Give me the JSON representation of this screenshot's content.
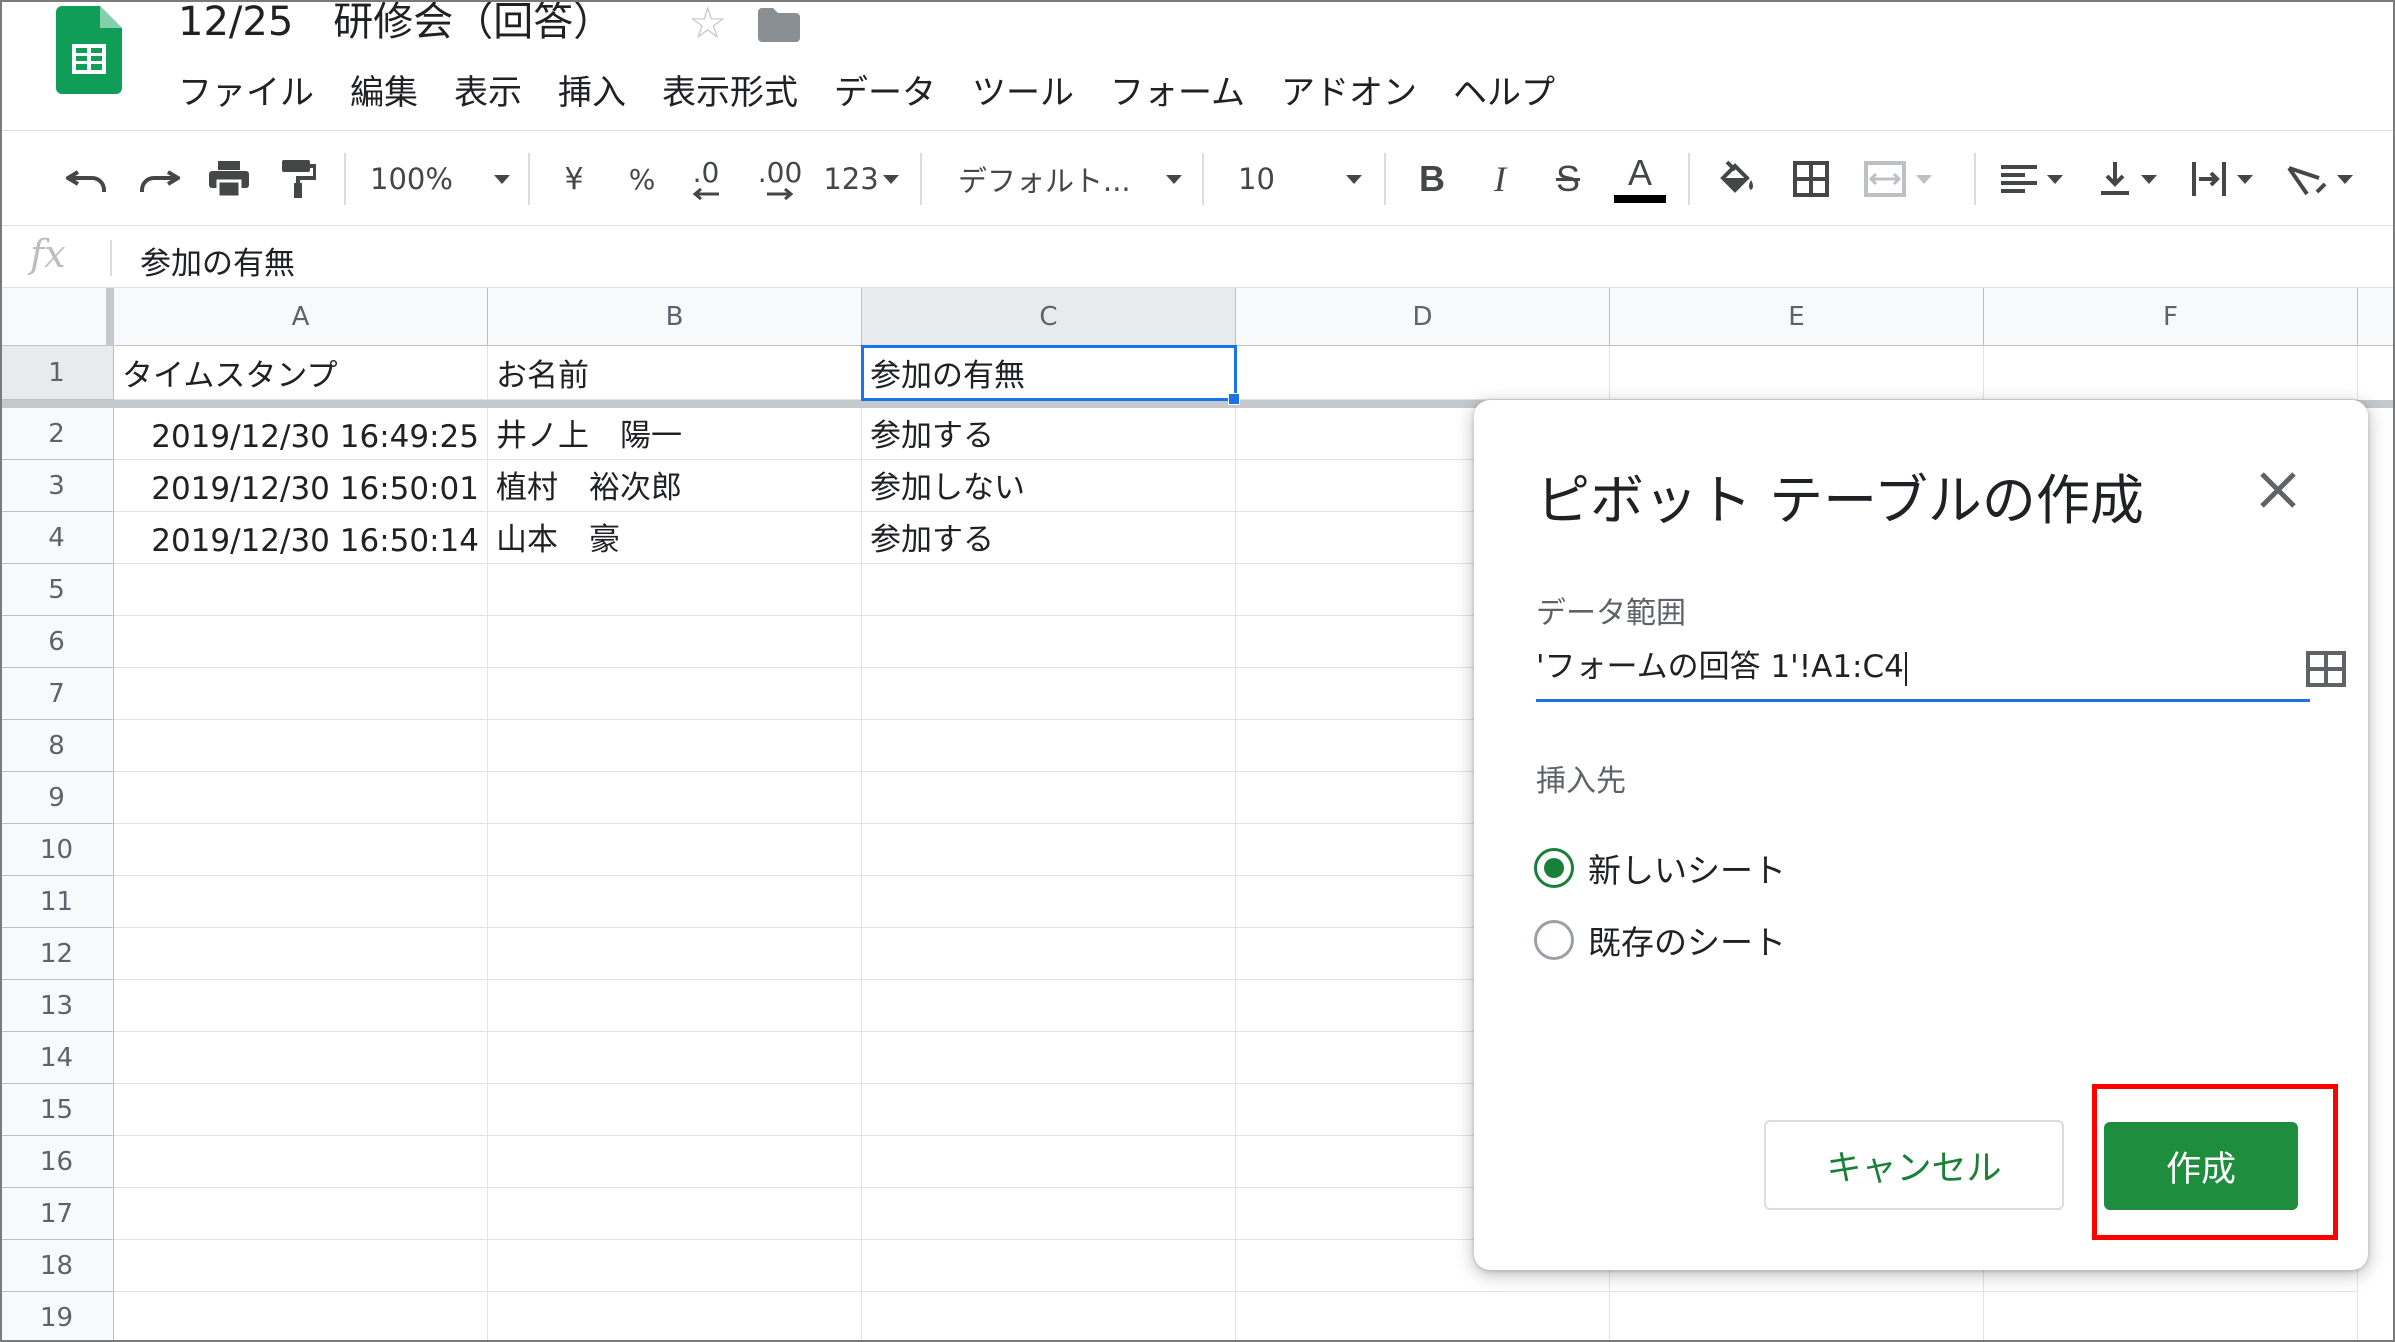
{
  "app": {
    "title": "12/25　研修会（回答）",
    "colors": {
      "brand_green": "#188038",
      "sheets_icon_green": "#0f9d58",
      "selection_blue": "#1a73e8",
      "highlight_red": "#ff0000"
    }
  },
  "menu": [
    "ファイル",
    "編集",
    "表示",
    "挿入",
    "表示形式",
    "データ",
    "ツール",
    "フォーム",
    "アドオン",
    "ヘルプ"
  ],
  "toolbar": {
    "zoom": "100%",
    "currency": "¥",
    "percent": "%",
    "decimal_decrease": ".0",
    "decimal_increase": ".00",
    "more_formats": "123",
    "font": "デフォルト...",
    "font_size": "10",
    "bold": "B",
    "italic": "I",
    "strikethrough": "S",
    "text_color": "A"
  },
  "formula_bar": {
    "fx": "fx",
    "content": "参加の有無"
  },
  "grid": {
    "columns": [
      "A",
      "B",
      "C",
      "D",
      "E",
      "F"
    ],
    "rows": [
      "1",
      "2",
      "3",
      "4",
      "5",
      "6",
      "7",
      "8",
      "9",
      "10",
      "11",
      "12",
      "13",
      "14",
      "15",
      "16",
      "17",
      "18",
      "19"
    ],
    "header_row": [
      "タイムスタンプ",
      "お名前",
      "参加の有無"
    ],
    "data_rows": [
      {
        "timestamp": "2019/12/30 16:49:25",
        "name": "井ノ上　陽一",
        "attendance": "参加する"
      },
      {
        "timestamp": "2019/12/30 16:50:01",
        "name": "植村　裕次郎",
        "attendance": "参加しない"
      },
      {
        "timestamp": "2019/12/30 16:50:14",
        "name": "山本　豪",
        "attendance": "参加する"
      }
    ]
  },
  "dialog": {
    "title": "ピボット テーブルの作成",
    "range_label": "データ範囲",
    "range_value": "'フォームの回答 1'!A1:C4",
    "insert_label": "挿入先",
    "options": [
      "新しいシート",
      "既存のシート"
    ],
    "selected_option": "新しいシート",
    "cancel_label": "キャンセル",
    "create_label": "作成"
  }
}
